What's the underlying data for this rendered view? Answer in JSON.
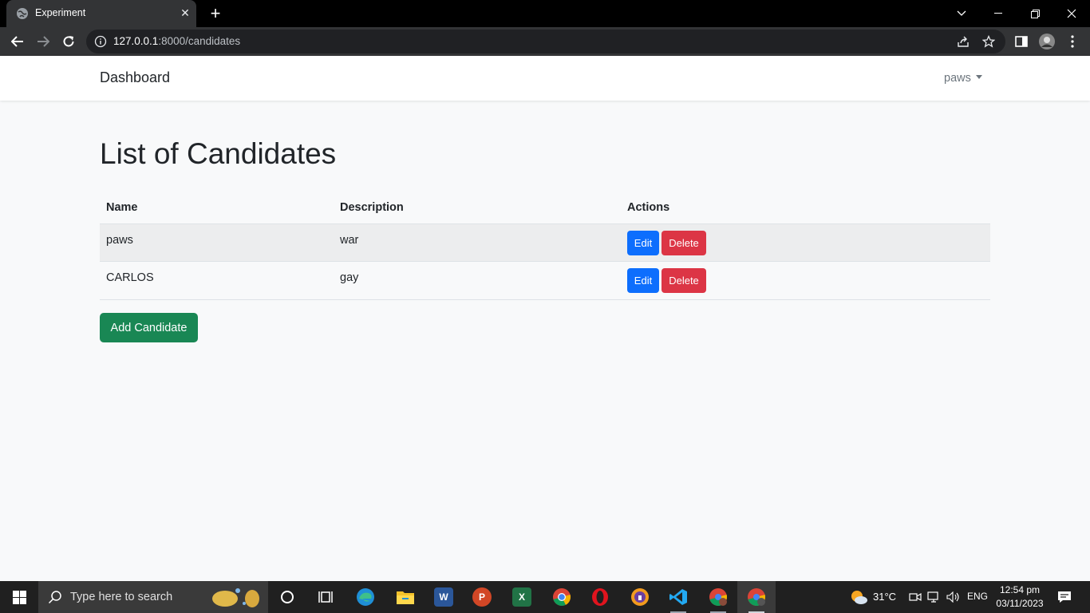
{
  "browser": {
    "tab_title": "Experiment",
    "url_host": "127.0.0.1",
    "url_rest": ":8000/candidates"
  },
  "navbar": {
    "brand": "Dashboard",
    "user": "paws"
  },
  "page": {
    "title": "List of Candidates",
    "columns": [
      "Name",
      "Description",
      "Actions"
    ],
    "rows": [
      {
        "name": "paws",
        "description": "war",
        "edit": "Edit",
        "delete": "Delete"
      },
      {
        "name": "CARLOS",
        "description": "gay",
        "edit": "Edit",
        "delete": "Delete"
      }
    ],
    "add_button": "Add Candidate"
  },
  "taskbar": {
    "search_placeholder": "Type here to search",
    "weather": "31°C",
    "language": "ENG",
    "time": "12:54 pm",
    "date": "03/11/2023"
  },
  "colors": {
    "edit": "#0d6efd",
    "delete": "#dc3545",
    "add": "#198754"
  }
}
